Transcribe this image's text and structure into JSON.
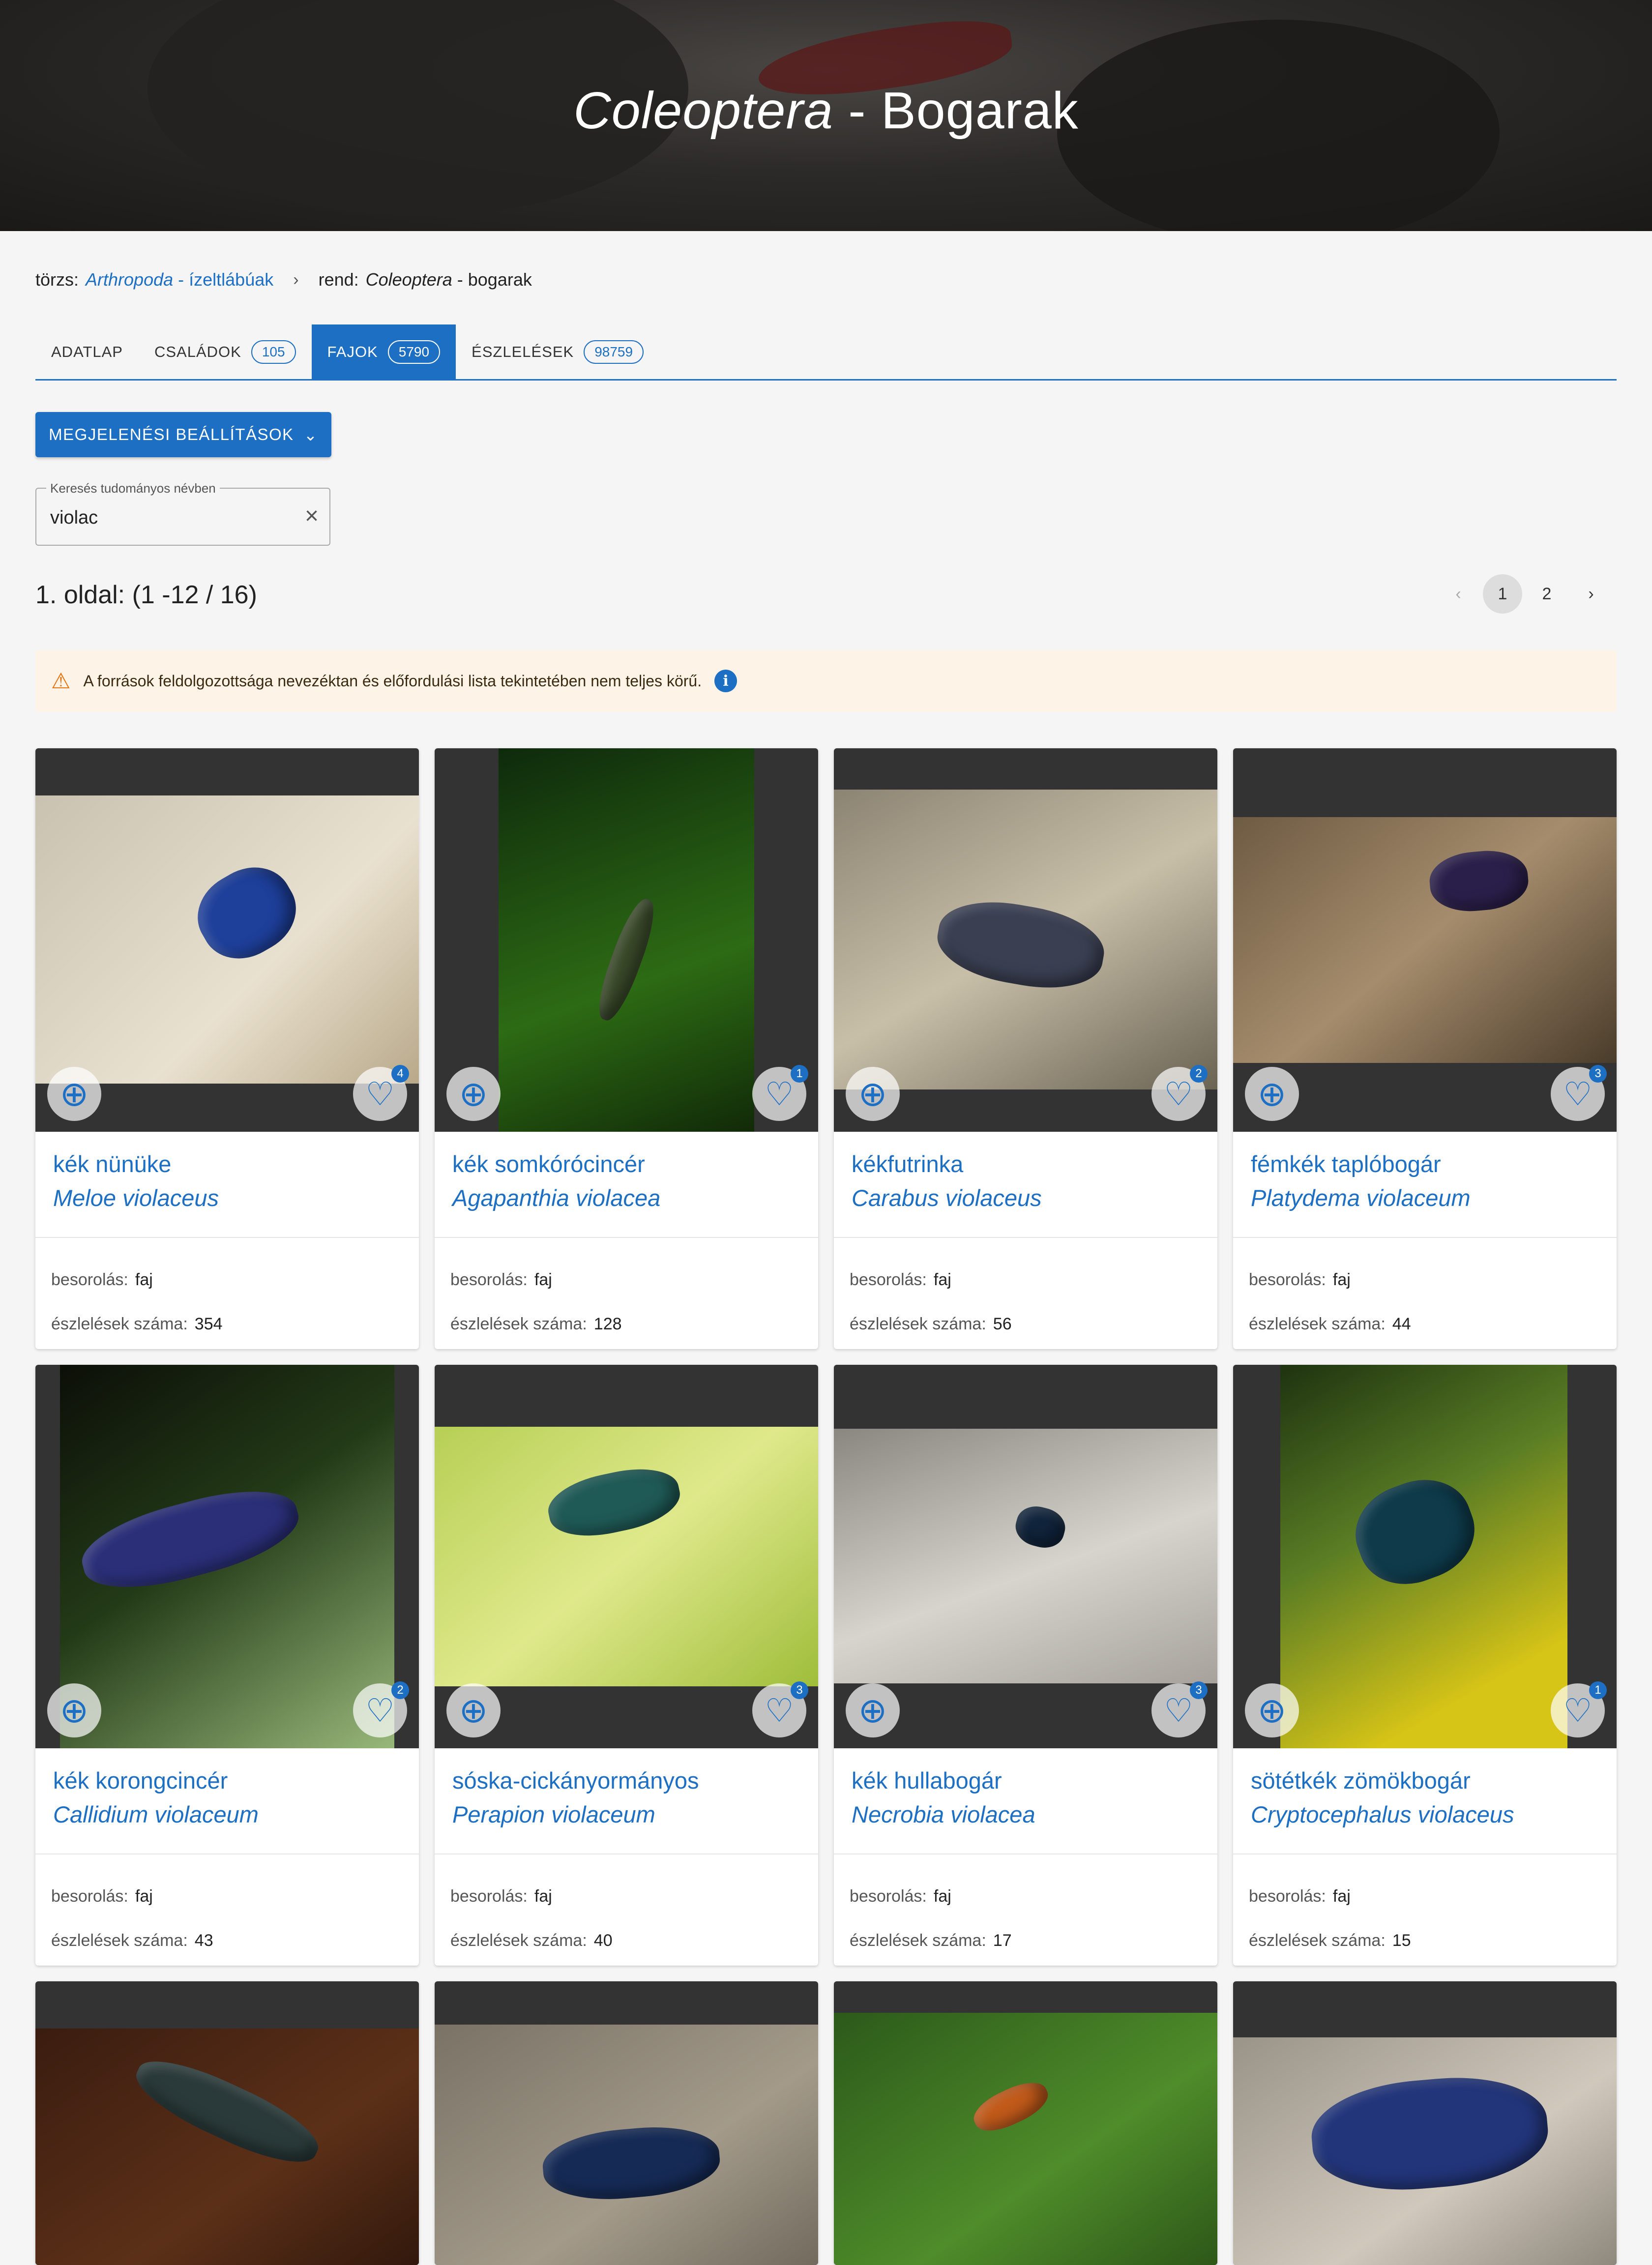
{
  "hero": {
    "title_italic": "Coleoptera",
    "title_rest": " - Bogarak"
  },
  "breadcrumb": {
    "phylum_label": "törzs:",
    "phylum_sci": "Arthropoda",
    "phylum_common": " - ízeltlábúak",
    "order_label": "rend:",
    "order_sci": "Coleoptera",
    "order_common": " - bogarak"
  },
  "tabs": [
    {
      "label": "Adatlap",
      "badge": ""
    },
    {
      "label": "Családok",
      "badge": "105"
    },
    {
      "label": "Fajok",
      "badge": "5790"
    },
    {
      "label": "Észlelések",
      "badge": "98759"
    }
  ],
  "settings_button": "MEGJELENÉSI BEÁLLÍTÁSOK",
  "search": {
    "label": "Keresés tudományos névben",
    "value": "violac"
  },
  "page_info": "1. oldal: (1 -12 / 16)",
  "pager": {
    "current": "1",
    "next": "2"
  },
  "alert_text": "A források feldolgozottsága nevezéktan és előfordulási lista tekintetében nem teljes körű.",
  "meta_labels": {
    "rank": "besorolás:",
    "count": "észlelések száma:"
  },
  "cards": [
    {
      "common": "kék nünüke",
      "sci": "Meloe violaceus",
      "rank": "faj",
      "count": "354",
      "favs": "4"
    },
    {
      "common": "kék somkórócincér",
      "sci": "Agapanthia violacea",
      "rank": "faj",
      "count": "128",
      "favs": "1"
    },
    {
      "common": "kékfutrinka",
      "sci": "Carabus violaceus",
      "rank": "faj",
      "count": "56",
      "favs": "2"
    },
    {
      "common": "fémkék taplóbogár",
      "sci": "Platydema violaceum",
      "rank": "faj",
      "count": "44",
      "favs": "3"
    },
    {
      "common": "kék korongcincér",
      "sci": "Callidium violaceum",
      "rank": "faj",
      "count": "43",
      "favs": "2"
    },
    {
      "common": "sóska-cickányormányos",
      "sci": "Perapion violaceum",
      "rank": "faj",
      "count": "40",
      "favs": "3"
    },
    {
      "common": "kék hullabogár",
      "sci": "Necrobia violacea",
      "rank": "faj",
      "count": "17",
      "favs": "3"
    },
    {
      "common": "sötétkék zömökbogár",
      "sci": "Cryptocephalus violaceus",
      "rank": "faj",
      "count": "15",
      "favs": "1"
    },
    {
      "common": "",
      "sci": "",
      "rank": "",
      "count": "",
      "favs": ""
    },
    {
      "common": "",
      "sci": "",
      "rank": "",
      "count": "",
      "favs": ""
    },
    {
      "common": "",
      "sci": "",
      "rank": "",
      "count": "",
      "favs": ""
    },
    {
      "common": "",
      "sci": "",
      "rank": "",
      "count": "",
      "favs": ""
    }
  ],
  "icons": {
    "zoom": "zoom-in-icon",
    "favorite": "heart-icon",
    "warning": "warning-icon",
    "info": "info-icon",
    "clear": "close-icon"
  },
  "colors": {
    "accent": "#1d6fc4",
    "alert_bg": "#fdf3e7",
    "warning": "#e8710a"
  }
}
